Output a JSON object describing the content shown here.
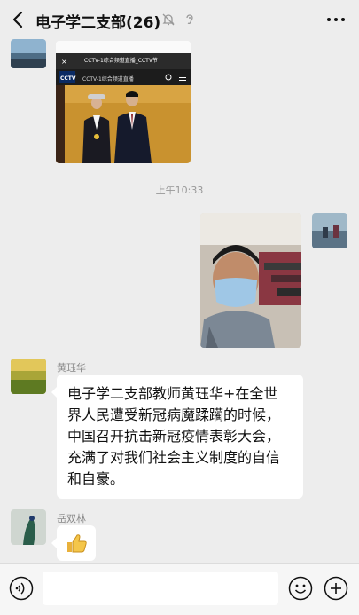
{
  "header": {
    "title": "电子学二支部(26)",
    "back_icon": "chevron-left-icon",
    "mute_icon": "bell-muted-icon",
    "ear_icon": "earpiece-icon",
    "more_icon": "more-dots-icon"
  },
  "messages": {
    "screenshot_msg": {
      "tab_title": "CCTV-1综合频道直播_CCTV节",
      "channel_label": "CCTV-1综合频道直播",
      "logo_text": "CCTV"
    },
    "timestamp": "上午10:33",
    "selfie_msg": {
      "kind": "photo"
    },
    "text_msg": {
      "sender": "黄珏华",
      "lines": [
        "电子学二支部教师黄珏华+在全世",
        "界人民遭受新冠病魔蹂躏的时候，",
        "中国召开抗击新冠疫情表彰大会，",
        "充满了对我们社会主义制度的自信",
        "和自豪。"
      ]
    },
    "thumb_msg": {
      "sender": "岳双林",
      "emoji_icon": "thumbs-up-icon"
    }
  },
  "input_bar": {
    "voice_icon": "voice-icon",
    "input_value": "",
    "emoji_icon": "smiley-icon",
    "plus_icon": "plus-circle-icon"
  },
  "colors": {
    "background": "#ededed",
    "bubble": "#ffffff",
    "muted_text": "#888888"
  }
}
